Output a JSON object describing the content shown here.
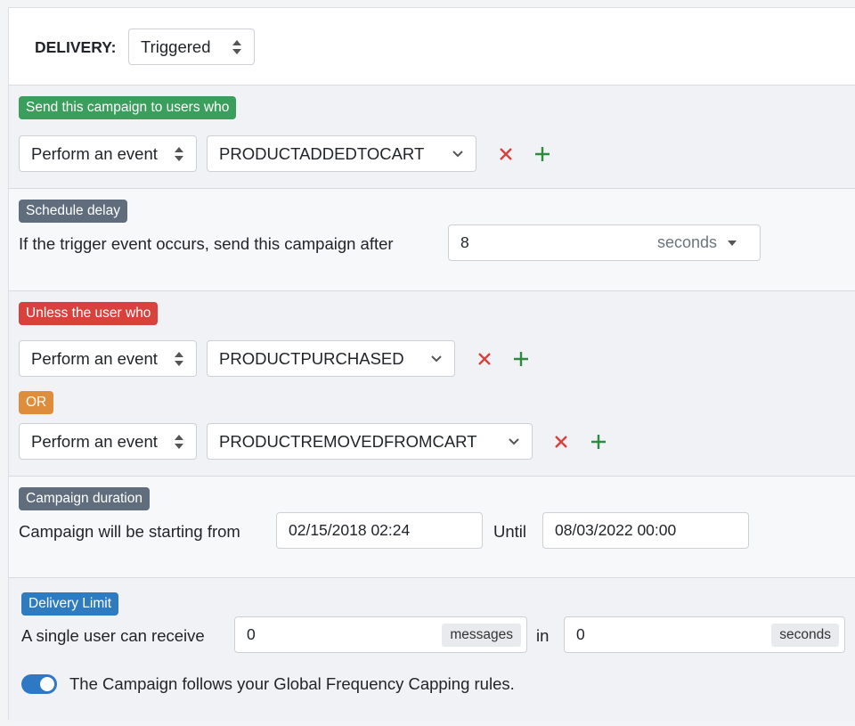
{
  "delivery": {
    "label": "DELIVERY:",
    "value": "Triggered"
  },
  "send_section": {
    "badge": "Send this campaign to users who",
    "condition_type": "Perform an event",
    "event": "PRODUCTADDEDTOCART"
  },
  "schedule": {
    "badge": "Schedule delay",
    "text": "If the trigger event occurs, send this campaign after",
    "value": "8",
    "unit": "seconds"
  },
  "unless": {
    "badge": "Unless the user who",
    "rows": [
      {
        "condition_type": "Perform an event",
        "event": "PRODUCTPURCHASED"
      },
      {
        "condition_type": "Perform an event",
        "event": "PRODUCTREMOVEDFROMCART"
      }
    ],
    "or_label": "OR"
  },
  "duration": {
    "badge": "Campaign duration",
    "start_label": "Campaign will be starting from",
    "start_value": "02/15/2018 02:24",
    "until_label": "Until",
    "end_value": "08/03/2022 00:00"
  },
  "limit": {
    "badge": "Delivery Limit",
    "text": "A single user can receive",
    "messages_value": "0",
    "messages_unit": "messages",
    "in_label": "in",
    "seconds_value": "0",
    "seconds_unit": "seconds",
    "frequency_capping_label": "The Campaign follows your Global Frequency Capping rules.",
    "frequency_capping_enabled": true
  },
  "colors": {
    "remove": "#d9423c",
    "add": "#2e8b3e",
    "toggle": "#2f78c4"
  }
}
